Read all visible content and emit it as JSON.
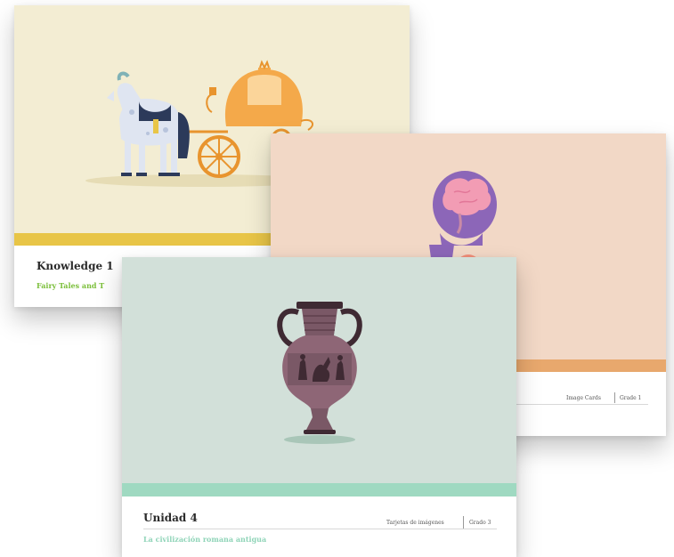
{
  "cards": {
    "knowledge": {
      "title": "Knowledge 1",
      "subtitle": "Fairy Tales and T",
      "art_bg": "#f3edd3",
      "band_color": "#e8c547",
      "subtitle_color": "#7bbf3a",
      "illustration": "horse-carriage-illustration"
    },
    "image_cards": {
      "meta_type": "Image Cards",
      "meta_grade": "Grade 1",
      "art_bg": "#f2d8c6",
      "band_color": "#e8a86d",
      "illustration": "human-body-illustration"
    },
    "unidad": {
      "title": "Unidad 4",
      "subtitle": "La civilización romana antigua",
      "meta_type": "Tarjetas de imágenes",
      "meta_grade": "Grado 3",
      "art_bg": "#d2e0d9",
      "band_color": "#9fd9c1",
      "subtitle_color": "#8fd4b8",
      "illustration": "amphora-vase-illustration"
    }
  }
}
